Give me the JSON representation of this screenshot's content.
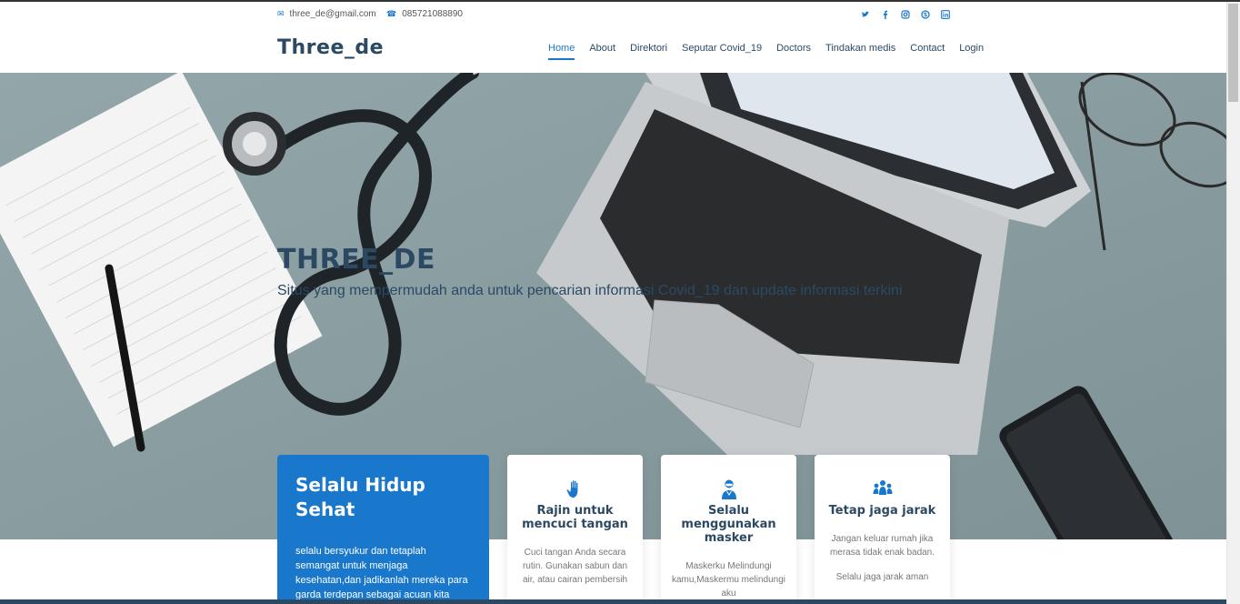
{
  "topbar": {
    "email": "three_de@gmail.com",
    "phone": "085721088890",
    "social_icons": [
      "twitter-icon",
      "facebook-icon",
      "instagram-icon",
      "skype-icon",
      "linkedin-icon"
    ]
  },
  "header": {
    "logo": "Three_de",
    "nav": [
      {
        "label": "Home",
        "active": true
      },
      {
        "label": "About"
      },
      {
        "label": "Direktori"
      },
      {
        "label": "Seputar Covid_19"
      },
      {
        "label": "Doctors"
      },
      {
        "label": "Tindakan medis"
      },
      {
        "label": "Contact"
      },
      {
        "label": "Login"
      }
    ]
  },
  "hero": {
    "title": "THREE_DE",
    "subtitle": "Situs yang mempermudah anda untuk pencarian informasi Covid_19 dan update informasi terkini"
  },
  "why": {
    "title": "Selalu Hidup Sehat",
    "text": "selalu bersyukur dan tetaplah semangat untuk menjaga kesehatan,dan jadikanlah mereka para garda terdepan sebagai acuan kita"
  },
  "cards": [
    {
      "icon": "hand-icon",
      "title": "Rajin untuk mencuci tangan",
      "text": "Cuci tangan Anda secara rutin. Gunakan sabun dan air, atau cairan pembersih"
    },
    {
      "icon": "masked-person-icon",
      "title": "Selalu menggunakan masker",
      "text": "Maskerku Melindungi kamu,Maskermu melindungi aku"
    },
    {
      "icon": "people-group-icon",
      "title": "Tetap jaga jarak",
      "text": "Jangan keluar rumah jika merasa tidak enak badan.",
      "text2": "Selalu jaga jarak aman"
    }
  ],
  "colors": {
    "accent": "#1977cc",
    "heading": "#2c4964",
    "hero_bg": "#8fa2a6"
  }
}
